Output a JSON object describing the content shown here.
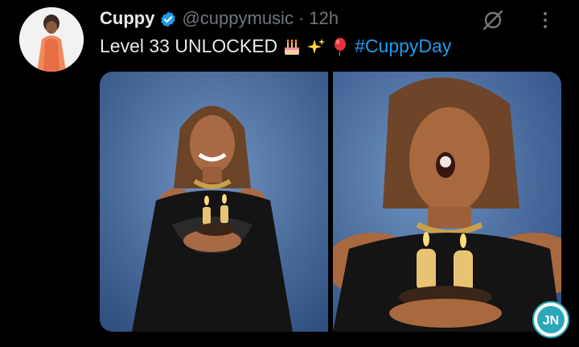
{
  "tweet": {
    "display_name": "Cuppy",
    "handle": "@cuppymusic",
    "separator": "·",
    "time": "12h",
    "text_main": "Level 33 UNLOCKED",
    "hashtag": "#CuppyDay",
    "emojis": [
      "birthday-cake-icon",
      "sparkles-icon",
      "balloon-icon"
    ]
  },
  "media": {
    "count": 2,
    "candle_numbers": [
      "3",
      "3"
    ]
  },
  "watermark": {
    "text": "JN"
  },
  "colors": {
    "background": "#000000",
    "text": "#e7e9ea",
    "muted": "#71767b",
    "link": "#1d9bf0",
    "verified": "#1d9bf0",
    "photo_backdrop": "#4f77a8",
    "dress": "#141414"
  }
}
